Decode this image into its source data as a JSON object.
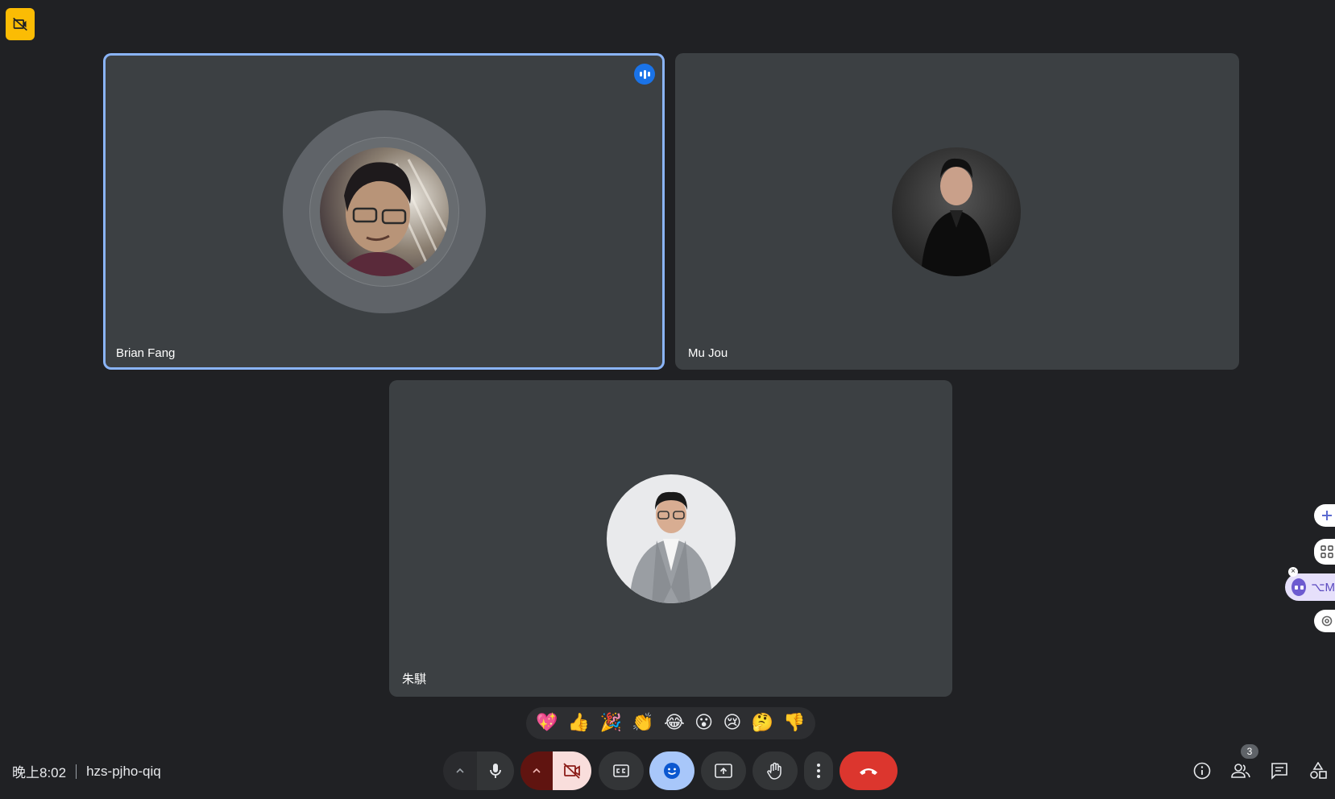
{
  "participants": [
    {
      "name": "Brian Fang",
      "speaking": true
    },
    {
      "name": "Mu Jou",
      "speaking": false
    },
    {
      "name": "朱騏",
      "speaking": false
    }
  ],
  "reactions": [
    "💖",
    "👍",
    "🎉",
    "👏",
    "😂",
    "😮",
    "😢",
    "🤔",
    "👎"
  ],
  "meeting": {
    "time": "晚上8:02",
    "code": "hzs-pjho-qiq"
  },
  "people_count": "3",
  "side_panel_text": "⌥M",
  "colors": {
    "background": "#202124",
    "tile": "#3c4043",
    "active_border": "#8ab4f8",
    "hangup": "#ea4335",
    "camera_off_bg": "#f9dedc",
    "emoji_active_bg": "#a8c7fa"
  }
}
